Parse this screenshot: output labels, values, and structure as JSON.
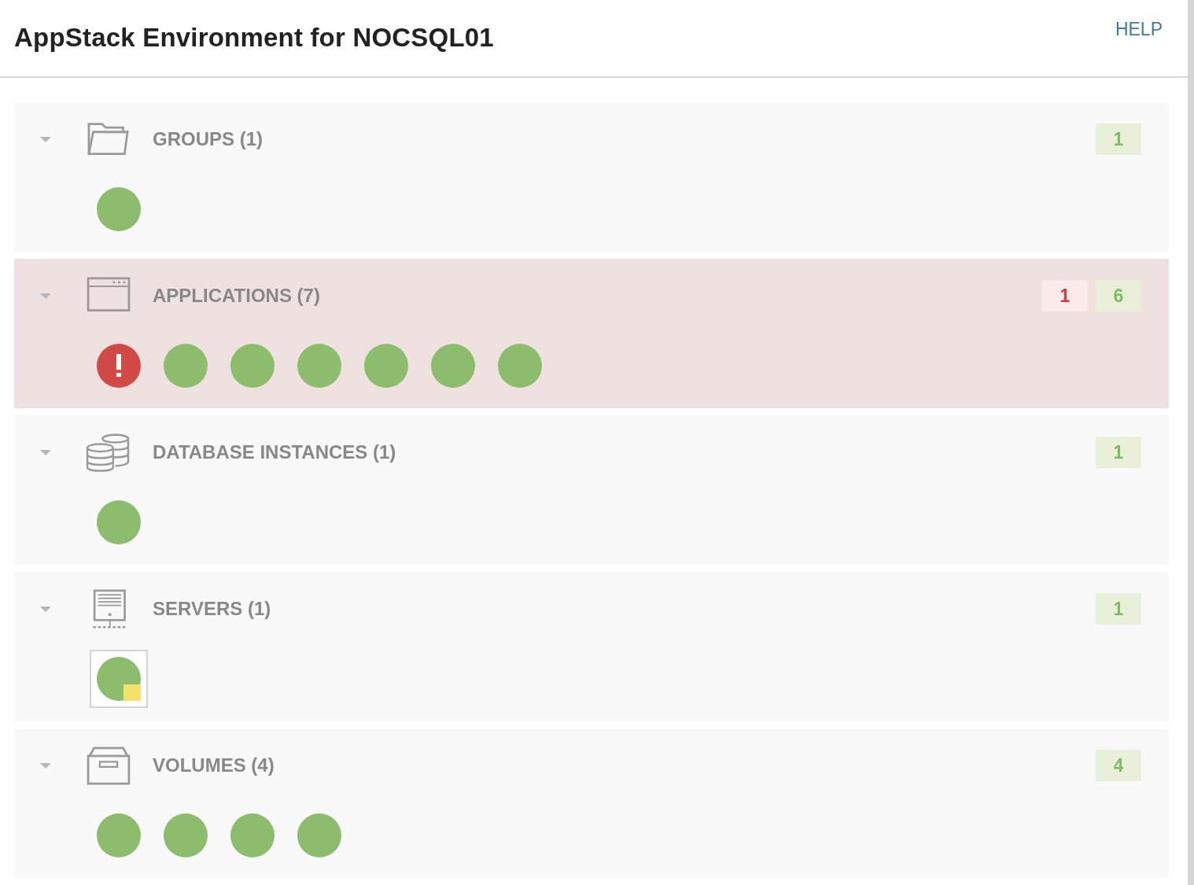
{
  "title": "AppStack Environment for NOCSQL01",
  "help": "HELP",
  "sections": [
    {
      "kind": "groups",
      "title": "GROUPS (1)",
      "expanded": true,
      "alert": false,
      "counts": [
        {
          "kind": "ok",
          "text": "1"
        }
      ],
      "items": [
        {
          "kind": "ok",
          "selected": false
        }
      ]
    },
    {
      "kind": "applications",
      "title": "APPLICATIONS (7)",
      "expanded": true,
      "alert": true,
      "counts": [
        {
          "kind": "critical",
          "text": "1"
        },
        {
          "kind": "ok",
          "text": "6"
        }
      ],
      "items": [
        {
          "kind": "critical",
          "selected": false
        },
        {
          "kind": "ok",
          "selected": false
        },
        {
          "kind": "ok",
          "selected": false
        },
        {
          "kind": "ok",
          "selected": false
        },
        {
          "kind": "ok",
          "selected": false
        },
        {
          "kind": "ok",
          "selected": false
        },
        {
          "kind": "ok",
          "selected": false
        }
      ]
    },
    {
      "kind": "databases",
      "title": "DATABASE INSTANCES (1)",
      "expanded": true,
      "alert": false,
      "counts": [
        {
          "kind": "ok",
          "text": "1"
        }
      ],
      "items": [
        {
          "kind": "ok",
          "selected": false
        }
      ]
    },
    {
      "kind": "servers",
      "title": "SERVERS (1)",
      "expanded": true,
      "alert": false,
      "counts": [
        {
          "kind": "ok",
          "text": "1"
        }
      ],
      "items": [
        {
          "kind": "warning",
          "selected": true
        }
      ]
    },
    {
      "kind": "volumes",
      "title": "VOLUMES (4)",
      "expanded": true,
      "alert": false,
      "counts": [
        {
          "kind": "ok",
          "text": "4"
        }
      ],
      "items": [
        {
          "kind": "ok",
          "selected": false
        },
        {
          "kind": "ok",
          "selected": false
        },
        {
          "kind": "ok",
          "selected": false
        },
        {
          "kind": "ok",
          "selected": false
        }
      ]
    }
  ]
}
